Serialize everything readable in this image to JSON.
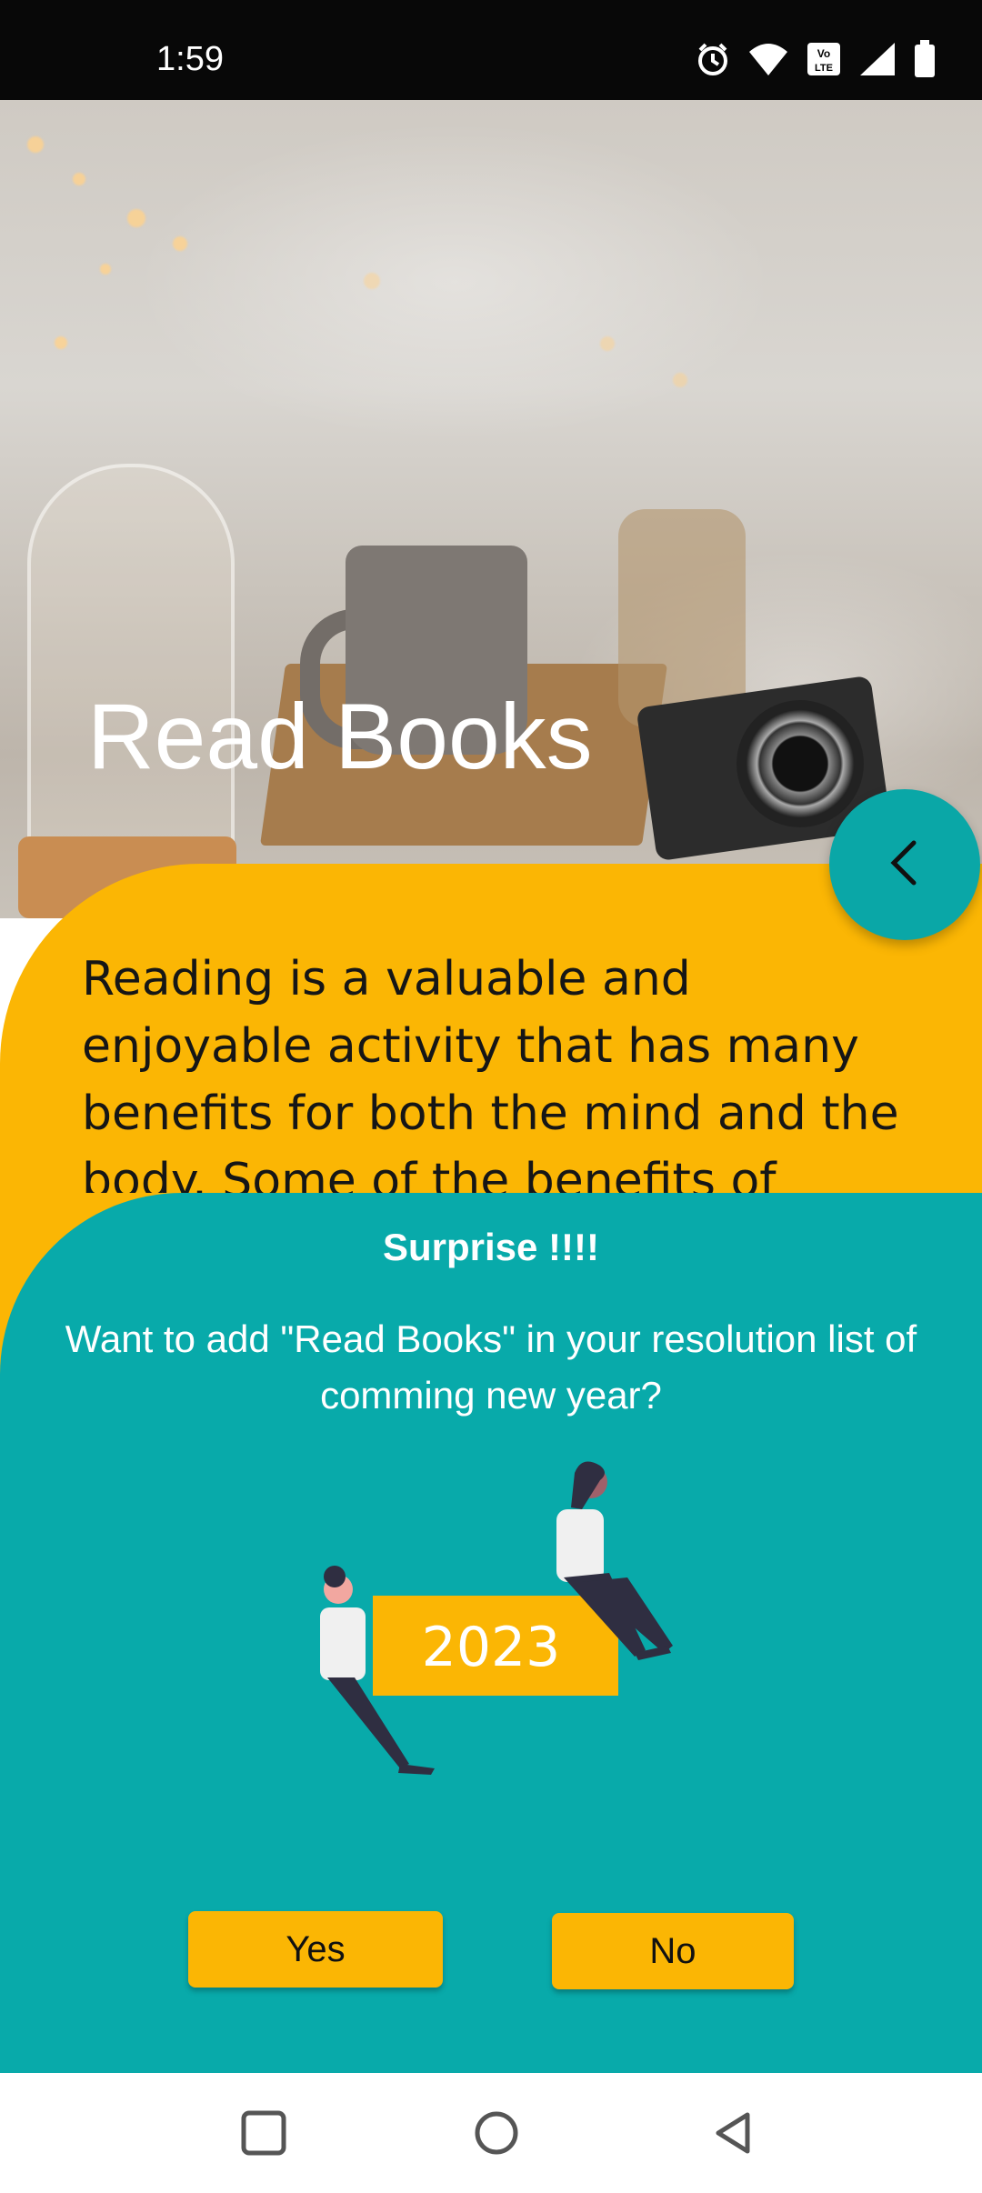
{
  "status_bar": {
    "time": "1:59",
    "icons": [
      "alarm-icon",
      "wifi-icon",
      "volte-icon",
      "signal-icon",
      "battery-icon"
    ]
  },
  "hero": {
    "title": "Read Books"
  },
  "content": {
    "body": "Reading is a valuable and enjoyable activity that has many benefits for both the mind and the body. Some of the benefits of reading include:"
  },
  "back_button": {
    "icon": "chevron-left-icon"
  },
  "dialog": {
    "title": "Surprise !!!!",
    "message": "Want to add \"Read Books\" in your resolution list of comming new year?",
    "illustration_label": "2023",
    "yes_label": "Yes",
    "no_label": "No"
  },
  "nav_bar": {
    "icons": [
      "recents-square-icon",
      "home-circle-icon",
      "back-triangle-icon"
    ]
  },
  "colors": {
    "yellow": "#fbb604",
    "teal": "#08aaaa",
    "status_bar": "#080808"
  }
}
